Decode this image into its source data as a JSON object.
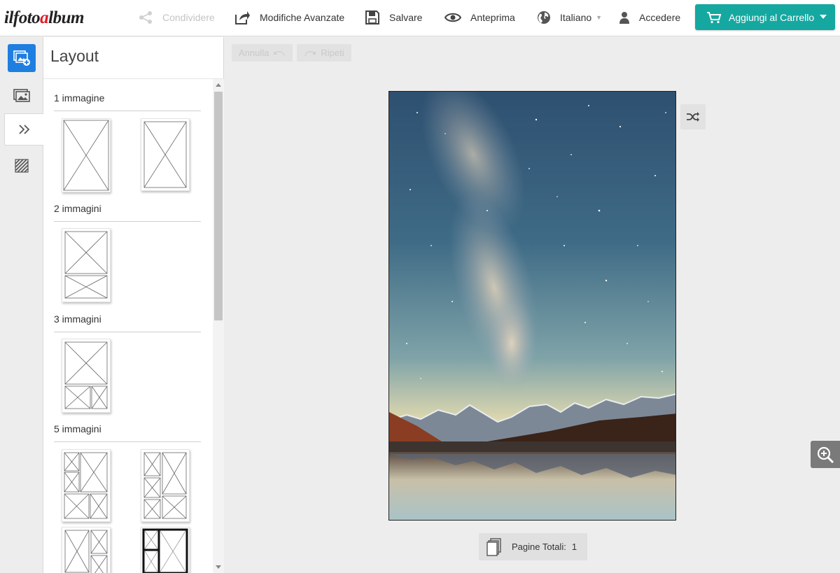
{
  "logo": {
    "part1": "ilfoto",
    "part2": "a",
    "part3": "lbum"
  },
  "header": {
    "share_label": "Condividere",
    "advanced_label": "Modifiche Avanzate",
    "save_label": "Salvare",
    "preview_label": "Anteprima",
    "language_label": "Italiano",
    "login_label": "Accedere",
    "cart_label": "Aggiungi al Carrello"
  },
  "colors": {
    "accent": "#15a8a0",
    "primary_blue": "#1e7fe0",
    "logo_red": "#e01b24"
  },
  "rail": {
    "items": [
      {
        "icon": "add-photos-icon"
      },
      {
        "icon": "gallery-icon"
      },
      {
        "icon": "layout-chevron-icon"
      },
      {
        "icon": "background-pattern-icon"
      }
    ]
  },
  "panel": {
    "title": "Layout",
    "sections": [
      {
        "label": "1 immagine"
      },
      {
        "label": "2 immagini"
      },
      {
        "label": "3 immagini"
      },
      {
        "label": "5 immagini"
      }
    ]
  },
  "toolbar": {
    "undo_label": "Annulla",
    "redo_label": "Ripeti"
  },
  "canvas": {
    "photo_description_icon": "starry-sky-photo"
  },
  "footer": {
    "pages_label": "Pagine Totali:",
    "pages_count": "1"
  }
}
